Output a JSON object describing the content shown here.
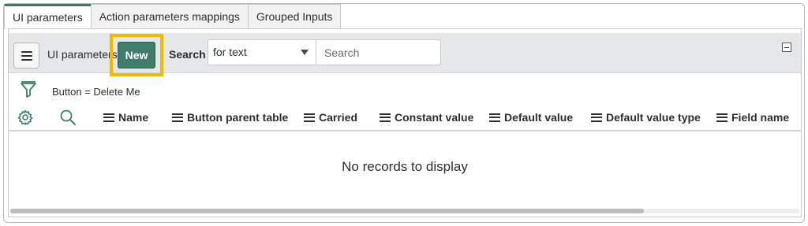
{
  "tabs": [
    {
      "label": "UI parameters",
      "active": true
    },
    {
      "label": "Action parameters mappings",
      "active": false
    },
    {
      "label": "Grouped Inputs",
      "active": false
    }
  ],
  "toolbar": {
    "list_title": "UI parameters",
    "new_label": "New",
    "search_label": "Search",
    "search_field_selected": "for text",
    "search_placeholder": "Search"
  },
  "filter": {
    "condition": "Button = Delete Me"
  },
  "columns": [
    "Name",
    "Button parent table",
    "Carried",
    "Constant value",
    "Default value",
    "Default value type",
    "Field name"
  ],
  "empty_message": "No records to display",
  "colors": {
    "accent": "#3f7d6a",
    "highlight": "#f5b800"
  },
  "icons": {
    "menu": "hamburger-icon",
    "filter": "funnel-icon",
    "settings": "gear-icon",
    "search": "magnifier-icon",
    "collapse": "collapse-icon"
  }
}
